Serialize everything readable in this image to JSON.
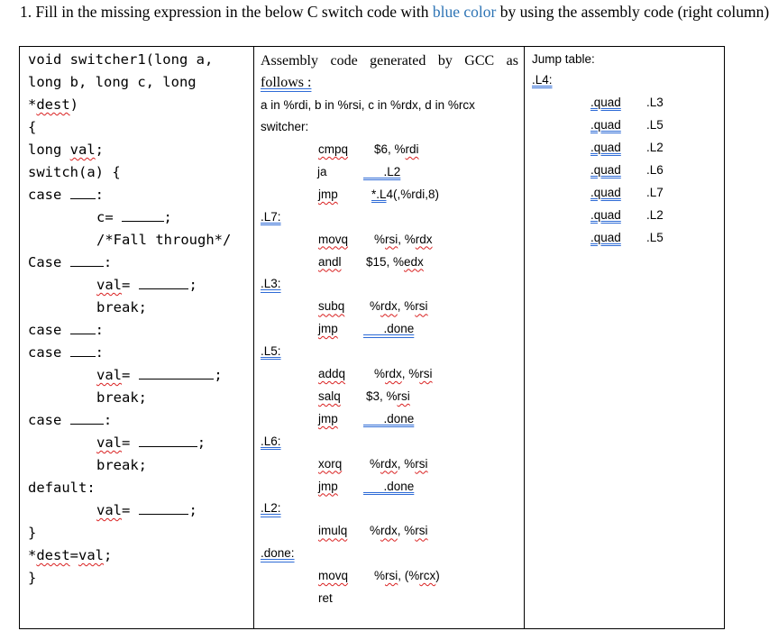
{
  "question": {
    "prefix": "1. Fill in the missing expression in the below C switch code with ",
    "highlight": "blue color",
    "suffix": " by using the assembly code (right column)",
    "highlight_color": "#2e74b5"
  },
  "c_code": {
    "lines": [
      {
        "indent": 0,
        "text": "void switcher1(long a,"
      },
      {
        "indent": 0,
        "text": "long b, long c, long"
      },
      {
        "indent": 0,
        "pre": "*",
        "squig": "dest",
        "post": ")"
      },
      {
        "indent": 0,
        "text": "{"
      },
      {
        "indent": 0,
        "pre": "long ",
        "squig": "val",
        "post": ";"
      },
      {
        "indent": 0,
        "text": "switch(a) {"
      },
      {
        "indent": 0,
        "pre": "case ",
        "blank": 3,
        "post": ":"
      },
      {
        "indent": 1,
        "pre": "c= ",
        "blank": 5,
        "post": ";"
      },
      {
        "indent": 1,
        "text": "/*Fall through*/"
      },
      {
        "indent": 0,
        "pre": "Case ",
        "blank": 4,
        "post": ":"
      },
      {
        "indent": 1,
        "squig_pre": "val",
        "pre": "= ",
        "blank": 6,
        "post": ";"
      },
      {
        "indent": 1,
        "text": "break;"
      },
      {
        "indent": 0,
        "pre": "case ",
        "blank": 3,
        "post": ":"
      },
      {
        "indent": 0,
        "pre": "case ",
        "blank": 3,
        "post": ":"
      },
      {
        "indent": 1,
        "squig_pre": "val",
        "pre": "= ",
        "blank": 9,
        "post": ";"
      },
      {
        "indent": 1,
        "text": "break;"
      },
      {
        "indent": 0,
        "pre": "case ",
        "blank": 4,
        "post": ":"
      },
      {
        "indent": 1,
        "squig_pre": "val",
        "pre": "= ",
        "blank": 7,
        "post": ";"
      },
      {
        "indent": 1,
        "text": "break;"
      },
      {
        "indent": 0,
        "text": "default:"
      },
      {
        "indent": 1,
        "squig_pre": "val",
        "pre": "= ",
        "blank": 6,
        "post": ";"
      },
      {
        "indent": 0,
        "text": "}"
      },
      {
        "indent": 0,
        "text": "*dest=val;"
      },
      {
        "indent": 0,
        "text": "}"
      }
    ]
  },
  "assembly": {
    "header_line1": "Assembly code generated by GCC as",
    "header_line2": "follows :",
    "registers": "a in %rdi, b in %rsi, c in %rdx, d in %rcx",
    "switcher_label": "switcher:",
    "rows": [
      {
        "type": "instr",
        "mnemonic": "cmpq",
        "operands": "$6, %rdi"
      },
      {
        "type": "instr",
        "mnemonic": "ja",
        "operands": ".L2"
      },
      {
        "type": "instr",
        "mnemonic": "jmp",
        "operands": "*.L4(,%rdi,8)"
      },
      {
        "type": "label",
        "text": ".L7:"
      },
      {
        "type": "instr",
        "mnemonic": "movq",
        "operands": "%rsi, %rdx"
      },
      {
        "type": "instr",
        "mnemonic": "andl",
        "operands": "$15, %edx"
      },
      {
        "type": "label",
        "text": ".L3:"
      },
      {
        "type": "instr",
        "mnemonic": "subq",
        "operands": "%rdx, %rsi"
      },
      {
        "type": "instr",
        "mnemonic": "jmp",
        "operands": ".done"
      },
      {
        "type": "label",
        "text": ".L5:"
      },
      {
        "type": "instr",
        "mnemonic": "addq",
        "operands": "%rdx, %rsi"
      },
      {
        "type": "instr",
        "mnemonic": "salq",
        "operands": "$3, %rsi"
      },
      {
        "type": "instr",
        "mnemonic": "jmp",
        "operands": ".done"
      },
      {
        "type": "label",
        "text": ".L6:"
      },
      {
        "type": "instr",
        "mnemonic": "xorq",
        "operands": "%rdx, %rsi"
      },
      {
        "type": "instr",
        "mnemonic": "jmp",
        "operands": ".done"
      },
      {
        "type": "label",
        "text": ".L2:"
      },
      {
        "type": "instr",
        "mnemonic": "imulq",
        "operands": "%rdx, %rsi"
      },
      {
        "type": "label",
        "text": ".done:"
      },
      {
        "type": "instr",
        "mnemonic": "movq",
        "operands": "%rsi, (%rcx)"
      },
      {
        "type": "instr",
        "mnemonic": "ret",
        "operands": ""
      }
    ]
  },
  "jump_table": {
    "title": "Jump table:",
    "label": ".L4:",
    "entries": [
      {
        "directive": ".quad",
        "target": ".L3"
      },
      {
        "directive": ".quad",
        "target": ".L5"
      },
      {
        "directive": ".quad",
        "target": ".L2"
      },
      {
        "directive": ".quad",
        "target": ".L6"
      },
      {
        "directive": ".quad",
        "target": ".L7"
      },
      {
        "directive": ".quad",
        "target": ".L2"
      },
      {
        "directive": ".quad",
        "target": ".L5"
      }
    ]
  }
}
